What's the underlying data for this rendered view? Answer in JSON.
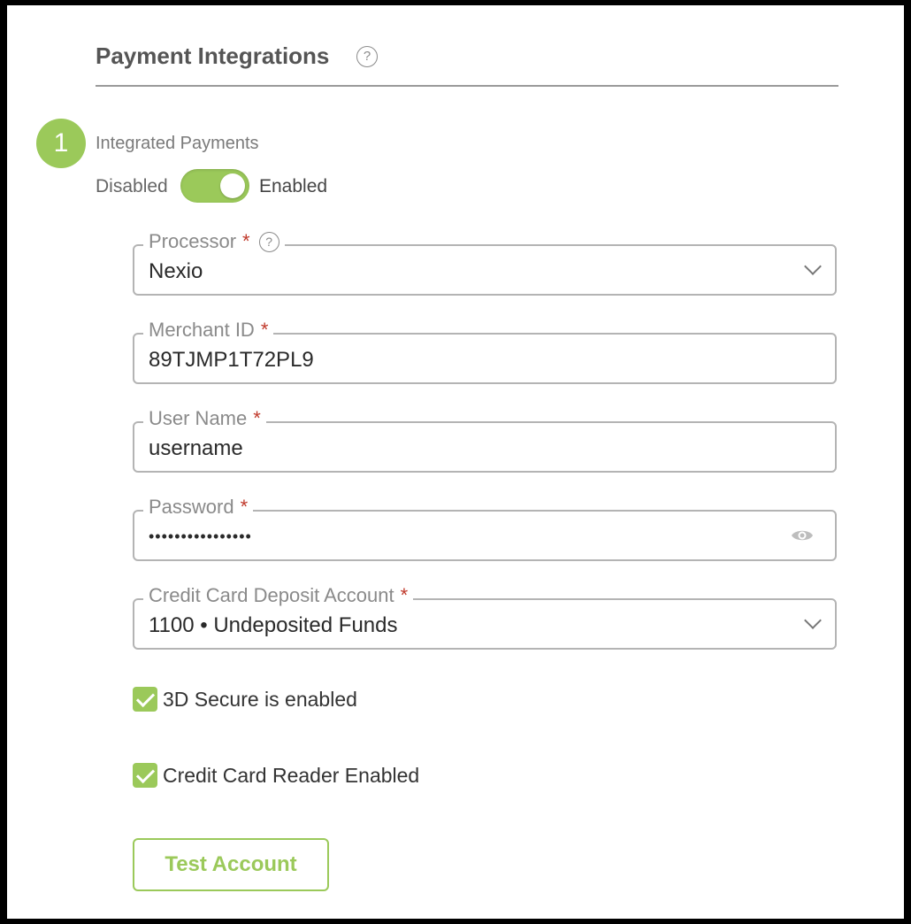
{
  "header": {
    "title": "Payment Integrations",
    "help_glyph": "?"
  },
  "step": {
    "number": "1",
    "label": "Integrated Payments"
  },
  "toggle": {
    "off_label": "Disabled",
    "on_label": "Enabled",
    "state": "enabled",
    "accent": "#9bc95a"
  },
  "fields": {
    "processor": {
      "label": "Processor",
      "required": "*",
      "value": "Nexio",
      "help_glyph": "?"
    },
    "merchant_id": {
      "label": "Merchant ID",
      "required": "*",
      "value": "89TJMP1T72PL9"
    },
    "user_name": {
      "label": "User Name",
      "required": "*",
      "value": "username"
    },
    "password": {
      "label": "Password",
      "required": "*",
      "value": "••••••••••••••••",
      "icon": "eye-icon"
    },
    "deposit_account": {
      "label": "Credit Card Deposit Account",
      "required": "*",
      "value": "1100 • Undeposited Funds"
    }
  },
  "checkboxes": {
    "secure_3d": {
      "label": "3D Secure is enabled",
      "checked": true
    },
    "card_reader": {
      "label": "Credit Card Reader Enabled",
      "checked": true
    }
  },
  "actions": {
    "test_account_label": "Test Account"
  }
}
